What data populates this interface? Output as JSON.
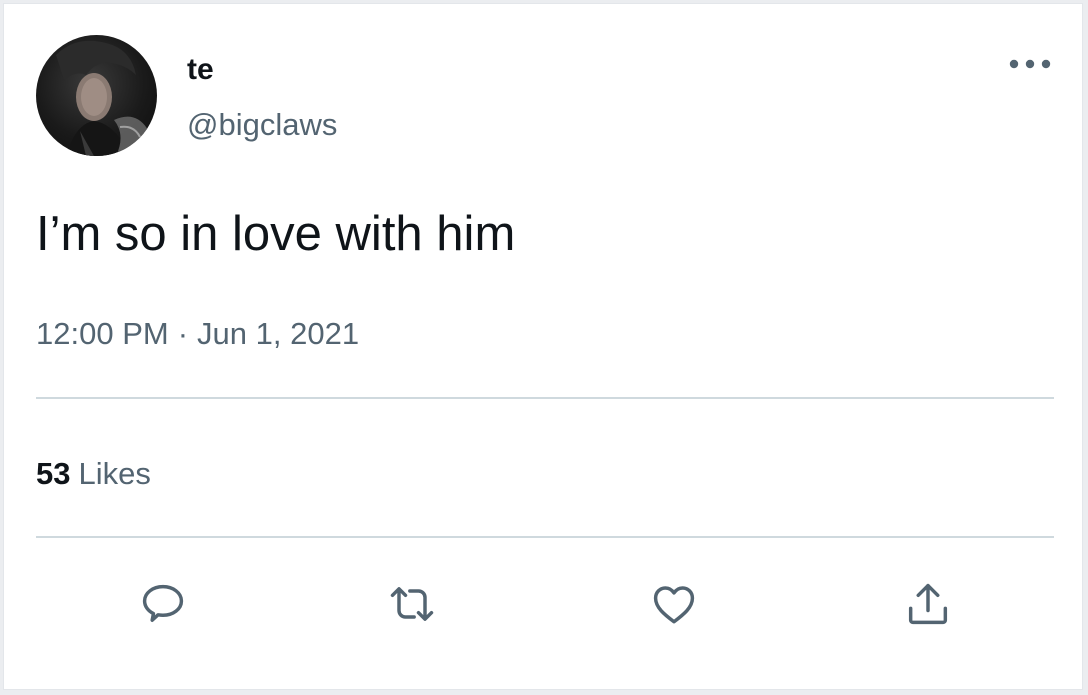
{
  "user": {
    "display_name": "te",
    "handle": "@bigclaws"
  },
  "tweet": {
    "text": "I’m so in love with him",
    "time": "12:00 PM",
    "separator": "·",
    "date": "Jun 1, 2021"
  },
  "stats": {
    "likes_count": "53",
    "likes_label": "Likes"
  },
  "icons": {
    "more": "more-dots-icon",
    "reply": "reply-icon",
    "retweet": "retweet-icon",
    "like": "heart-icon",
    "share": "share-icon"
  },
  "colors": {
    "text_primary": "#0f1419",
    "text_secondary": "#536471",
    "divider": "#cfd9de",
    "icon": "#536471"
  }
}
